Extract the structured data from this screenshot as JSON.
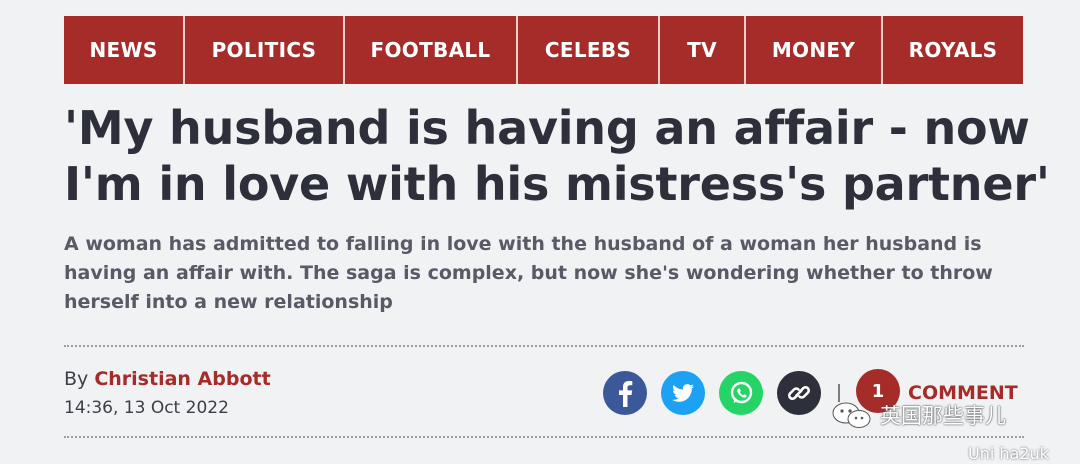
{
  "nav": {
    "items": [
      {
        "label": "NEWS"
      },
      {
        "label": "POLITICS"
      },
      {
        "label": "FOOTBALL"
      },
      {
        "label": "CELEBS"
      },
      {
        "label": "TV"
      },
      {
        "label": "MONEY"
      },
      {
        "label": "ROYALS"
      }
    ]
  },
  "article": {
    "headline": "'My husband is having an affair - now I'm in love with his mistress's partner'",
    "standfirst": "A woman has admitted to falling in love with the husband of a woman her husband is having an affair with. The saga is complex, but now she's wondering whether to throw herself into a new relationship",
    "byline_prefix": "By ",
    "author": "Christian Abbott",
    "timestamp": "14:36, 13 Oct 2022"
  },
  "share": {
    "icons": [
      "facebook-icon",
      "twitter-icon",
      "whatsapp-icon",
      "link-icon"
    ],
    "colors": {
      "facebook": "#3b5998",
      "twitter": "#1da1f2",
      "whatsapp": "#25d366",
      "link": "#2d2f3a"
    }
  },
  "comments": {
    "count": "1",
    "label": "COMMENT"
  },
  "watermark": {
    "text": "英国那些事儿",
    "text2": "Uni ha2uk"
  },
  "theme": {
    "accent": "#a62c2a",
    "background": "#f1f2f4",
    "headline_color": "#2d2f3a"
  }
}
